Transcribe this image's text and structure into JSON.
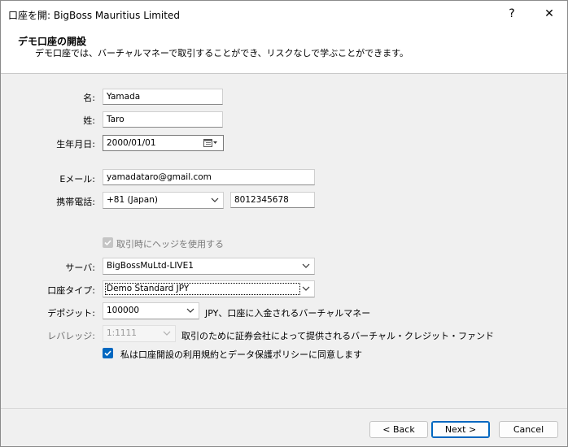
{
  "window": {
    "title": "口座を開: BigBoss Mauritius Limited",
    "help_glyph": "?",
    "close_glyph": "✕"
  },
  "header": {
    "title": "デモ口座の開設",
    "description": "デモ口座では、バーチャルマネーで取引することができ、リスクなしで学ぶことができます。"
  },
  "form": {
    "first_name_label": "名:",
    "first_name_value": "Yamada",
    "last_name_label": "姓:",
    "last_name_value": "Taro",
    "birth_label": "生年月日:",
    "birth_value": "2000/01/01",
    "email_label": "Eメール:",
    "email_value": "yamadataro@gmail.com",
    "phone_label": "携帯電話:",
    "phone_country_value": "+81 (Japan)",
    "phone_number_value": "8012345678",
    "hedge_label": "取引時にヘッジを使用する",
    "hedge_checked": true,
    "hedge_enabled": false,
    "server_label": "サーバ:",
    "server_value": "BigBossMuLtd-LIVE1",
    "account_type_label": "口座タイプ:",
    "account_type_value": "Demo Standard JPY",
    "deposit_label": "デポジット:",
    "deposit_value": "100000",
    "deposit_note": "JPY、口座に入金されるバーチャルマネー",
    "leverage_label": "レバレッジ:",
    "leverage_value": "1:1111",
    "leverage_note": "取引のために証券会社によって提供されるバーチャル・クレジット・ファンド",
    "agree_label": "私は口座開設の利用規約とデータ保護ポリシーに同意します",
    "agree_checked": true
  },
  "buttons": {
    "back": "< Back",
    "next": "Next >",
    "cancel": "Cancel"
  },
  "colors": {
    "accent": "#0067c0",
    "window_bg": "#f0f0f0",
    "header_bg": "#ffffff"
  }
}
